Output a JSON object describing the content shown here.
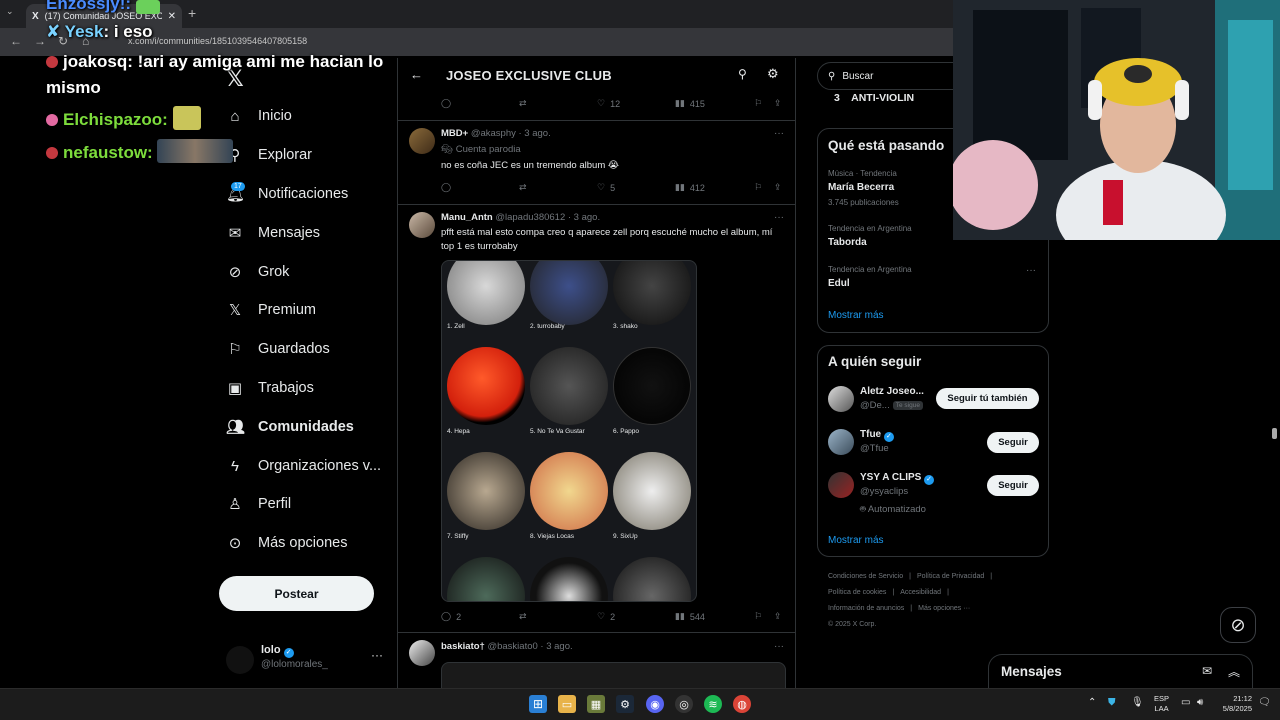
{
  "browser": {
    "tab_title": "(17) Comunidad JOSEO EXCLUS",
    "tab_favicon": "X",
    "url": "x.com/i/communities/1851039546407805158"
  },
  "chat": [
    {
      "user": "Enzossjy!:",
      "message": "",
      "color": "#4a8cff"
    },
    {
      "user": "Yesk",
      "message": ": i eso",
      "color": "#7ad2ff"
    },
    {
      "user": "joakosq:",
      "message": " !ari ay amiga ami me hacian lo",
      "color": "#ffffff"
    },
    {
      "user": "",
      "message": "mismo",
      "color": "#ffffff"
    },
    {
      "user": "Elchispazoo:",
      "message": "",
      "color": "#7ddc3c"
    },
    {
      "user": "nefaustow:",
      "message": "",
      "color": "#7ddc3c"
    }
  ],
  "sidebar": {
    "notification_count": "17",
    "items": [
      {
        "label": "Inicio",
        "icon": "home-icon",
        "glyph": "⌂"
      },
      {
        "label": "Explorar",
        "icon": "search-icon",
        "glyph": "⚲"
      },
      {
        "label": "Notificaciones",
        "icon": "bell-icon",
        "glyph": "🔔︎"
      },
      {
        "label": "Mensajes",
        "icon": "mail-icon",
        "glyph": "✉"
      },
      {
        "label": "Grok",
        "icon": "grok-icon",
        "glyph": "⊘"
      },
      {
        "label": "Premium",
        "icon": "x-logo-icon",
        "glyph": "𝕏"
      },
      {
        "label": "Guardados",
        "icon": "bookmark-icon",
        "glyph": "⚐"
      },
      {
        "label": "Trabajos",
        "icon": "briefcase-icon",
        "glyph": "▣"
      },
      {
        "label": "Comunidades",
        "icon": "people-icon",
        "glyph": "👥︎"
      },
      {
        "label": "Organizaciones v...",
        "icon": "lightning-icon",
        "glyph": "ϟ"
      },
      {
        "label": "Perfil",
        "icon": "person-icon",
        "glyph": "♙"
      },
      {
        "label": "Más opciones",
        "icon": "more-circle-icon",
        "glyph": "⊙"
      }
    ],
    "post_label": "Postear",
    "profile_name": "lolo",
    "profile_handle": "@lolomorales_"
  },
  "main": {
    "title": "JOSEO EXCLUSIVE CLUB",
    "tweets": [
      {
        "replies": "",
        "retweets": "",
        "likes": "12",
        "views": "415"
      },
      {
        "name": "MBD+",
        "handle": "@akasphy",
        "time": "· 3 ago.",
        "badge": "Cuenta parodia",
        "text": "no es coña JEC es un tremendo album 😭",
        "replies": "",
        "retweets": "",
        "likes": "5",
        "views": "412"
      },
      {
        "name": "Manu_Antn",
        "handle": "@lapadu380612",
        "time": "· 3 ago.",
        "text": "pfft está mal esto compa creo q aparece zell porq escuché mucho el album, mí top 1 es turrobaby",
        "albums": [
          "1. Zell",
          "2. turrobaby",
          "3. shako",
          "4. Hepa",
          "5. No Te Va Gustar",
          "6. Pappo",
          "7. Stiffy",
          "8. Viejas Locas",
          "9. SixUp"
        ],
        "replies": "2",
        "retweets": "",
        "likes": "2",
        "views": "544"
      },
      {
        "name": "baskiato†",
        "handle": "@baskiato0",
        "time": "· 3 ago."
      }
    ]
  },
  "right": {
    "search_placeholder": "Buscar",
    "rank_item": {
      "rank": "3",
      "label": "ANTI-VIOLIN"
    },
    "trends_title": "Qué está pasando",
    "trends": [
      {
        "category": "Música · Tendencia",
        "name": "María Becerra",
        "count": "3.745 publicaciones"
      },
      {
        "category": "Tendencia en Argentina",
        "name": "Taborda",
        "count": ""
      },
      {
        "category": "Tendencia en Argentina",
        "name": "Edul",
        "count": ""
      }
    ],
    "show_more": "Mostrar más",
    "follow_title": "A quién seguir",
    "follows": [
      {
        "name": "Aletz Joseo...",
        "handle": "@De...",
        "follows_you": "Te sigue",
        "button": "Seguir tú también"
      },
      {
        "name": "Tfue",
        "handle": "@Tfue",
        "button": "Seguir"
      },
      {
        "name": "YSY A CLIPS",
        "handle": "@ysyaclips",
        "auto": "Automatizado",
        "button": "Seguir"
      }
    ],
    "footer": {
      "line1a": "Condiciones de Servicio",
      "line1b": "Política de Privacidad",
      "line2a": "Política de cookies",
      "line2b": "Accesibilidad",
      "line3a": "Información de anuncios",
      "line3b": "Más opciones ···",
      "line4": "© 2025 X Corp."
    }
  },
  "messages_drawer": "Mensajes",
  "taskbar": {
    "lang_line1": "ESP",
    "lang_line2": "LAA",
    "time": "21:12",
    "date": "5/8/2025"
  },
  "colors": {
    "accent": "#1d9bf0",
    "background": "#000000",
    "border": "#2f3336",
    "muted": "#71767b"
  }
}
